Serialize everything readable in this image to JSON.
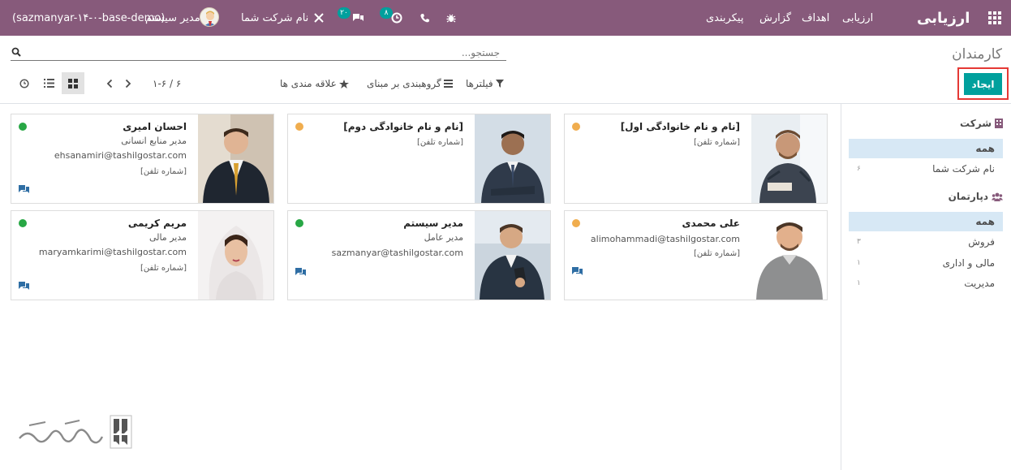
{
  "navbar": {
    "app_title": "ارزیابی",
    "menu": [
      "ارزیابی",
      "اهداف",
      "گزارش",
      "پیکربندی"
    ],
    "user_name": "مدیر سیستم",
    "db_name": "(sazmanyar-۱۴-۰-base-demo)",
    "company": "نام شرکت شما",
    "activity_count": "۸",
    "message_count": "۲۰",
    "icons": [
      "apps-grid-icon",
      "bug-icon",
      "phone-icon",
      "clock-icon",
      "chat-icon",
      "tools-icon",
      "user-avatar"
    ]
  },
  "control_panel": {
    "title": "کارمندان",
    "create_label": "ایجاد",
    "search_placeholder": "جستجو...",
    "filters_label": "فیلترها",
    "groupby_label": "گروهبندی بر مبنای",
    "favorites_label": "علاقه مندی ها",
    "pager": "۱-۶ / ۶"
  },
  "sidebar": {
    "company": {
      "heading": "شرکت",
      "items": [
        {
          "label": "همه",
          "count": "",
          "active": true
        },
        {
          "label": "نام شرکت شما",
          "count": "۶",
          "active": false
        }
      ]
    },
    "department": {
      "heading": "دپارتمان",
      "items": [
        {
          "label": "همه",
          "count": "",
          "active": true
        },
        {
          "label": "فروش",
          "count": "۳",
          "active": false
        },
        {
          "label": "مالی و اداری",
          "count": "۱",
          "active": false
        },
        {
          "label": "مدیریت",
          "count": "۱",
          "active": false
        }
      ]
    }
  },
  "employees": [
    {
      "name": "[نام و نام خانوادگی اول]",
      "job": "",
      "email": "",
      "phone": "[شماره تلفن]",
      "status": "away"
    },
    {
      "name": "[نام و نام خانوادگی دوم]",
      "job": "",
      "email": "",
      "phone": "[شماره تلفن]",
      "status": "away"
    },
    {
      "name": "احسان امیری",
      "job": "مدیر منابع انسانی",
      "email": "ehsanamiri@tashilgostar.com",
      "phone": "[شماره تلفن]",
      "status": "online"
    },
    {
      "name": "علی محمدی",
      "job": "",
      "email": "alimohammadi@tashilgostar.com",
      "phone": "[شماره تلفن]",
      "status": "away"
    },
    {
      "name": "مدیر سیستم",
      "job": "مدیر عامل",
      "email": "sazmanyar@tashilgostar.com",
      "phone": "",
      "status": "online"
    },
    {
      "name": "مریم کریمی",
      "job": "مدیر مالی",
      "email": "maryamkarimi@tashilgostar.com",
      "phone": "[شماره تلفن]",
      "status": "online"
    }
  ],
  "colors": {
    "brand": "#875a7b",
    "accent": "#00a09d",
    "online": "#28a745",
    "away": "#f0ad4e"
  }
}
